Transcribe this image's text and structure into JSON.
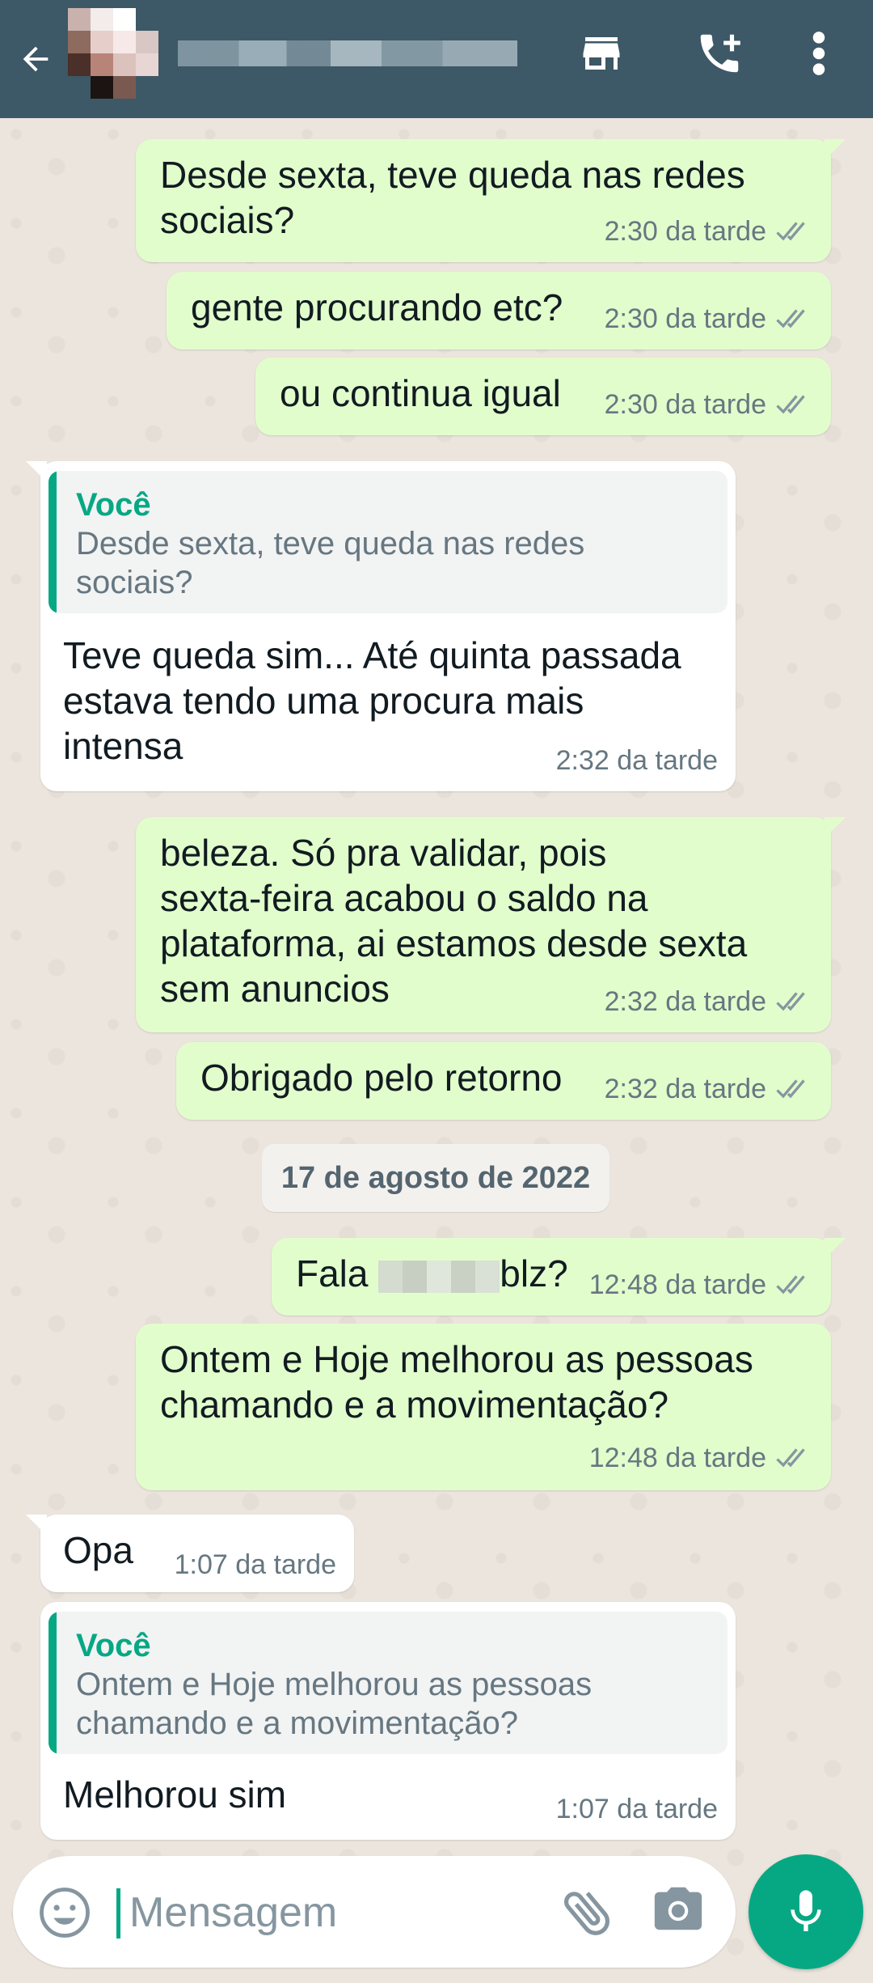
{
  "header": {
    "contact_name": "",
    "colors": {
      "bar": "#3D5866",
      "icons": "#FFFFFF"
    },
    "icons": [
      "back-arrow-icon",
      "store-icon",
      "add-call-icon",
      "more-vert-icon"
    ]
  },
  "messages": [
    {
      "dir": "out",
      "text": "Desde sexta, teve queda nas redes\nsociais?",
      "time": "2:30 da tarde",
      "status": "read"
    },
    {
      "dir": "out",
      "text": "gente procurando etc?",
      "time": "2:30 da tarde",
      "status": "read"
    },
    {
      "dir": "out",
      "text": "ou continua igual",
      "time": "2:30 da tarde",
      "status": "read"
    },
    {
      "dir": "in",
      "quote_author": "Você",
      "quote_text": "Desde sexta, teve queda nas redes\nsociais?",
      "text": "Teve queda sim... Até quinta passada\nestava tendo uma procura mais\nintensa",
      "time": "2:32 da tarde"
    },
    {
      "dir": "out",
      "text": "beleza. Só pra validar, pois\nsexta-feira acabou o saldo na\nplataforma, ai estamos desde sexta\nsem anuncios",
      "time": "2:32 da tarde",
      "status": "read"
    },
    {
      "dir": "out",
      "text": "Obrigado pelo retorno",
      "time": "2:32 da tarde",
      "status": "read"
    },
    {
      "dir": "out",
      "text_before": "Fala",
      "text_after": "blz?",
      "time": "12:48 da tarde",
      "status": "read"
    },
    {
      "dir": "out",
      "text": "Ontem e Hoje melhorou as pessoas\nchamando e a movimentação?",
      "time": "12:48 da tarde",
      "status": "read"
    },
    {
      "dir": "in",
      "text": "Opa",
      "time": "1:07 da tarde"
    },
    {
      "dir": "in",
      "quote_author": "Você",
      "quote_text": "Ontem e Hoje melhorou as pessoas\nchamando e a movimentação?",
      "text": "Melhorou sim",
      "time": "1:07 da tarde"
    }
  ],
  "date_separator": "17 de agosto de 2022",
  "composer": {
    "placeholder": "Mensagem",
    "icons": [
      "emoji-icon",
      "attach-icon",
      "camera-icon",
      "mic-icon"
    ]
  },
  "colors": {
    "outgoing_bubble": "#E2FDCC",
    "incoming_bubble": "#FFFFFF",
    "accent": "#06A884",
    "read_ticks": "#8696a0",
    "chat_background": "#ECE5DD"
  }
}
